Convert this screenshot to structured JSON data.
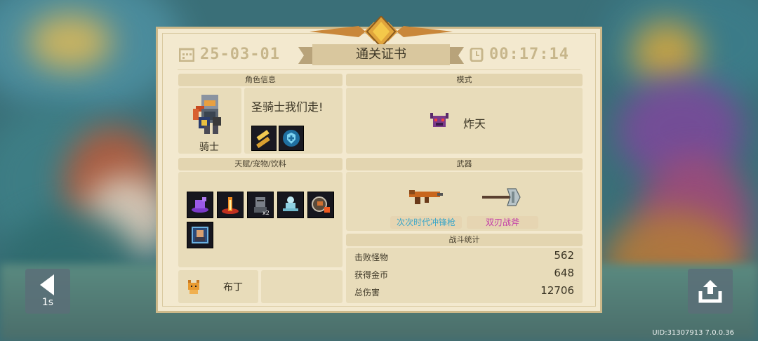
{
  "certificate": {
    "date": "25-03-01",
    "title": "通关证书",
    "time": "00:17:14"
  },
  "character": {
    "header": "角色信息",
    "hero_name": "骑士",
    "title_line": "圣骑士我们走!",
    "skills": [
      "golden-gun-skill-icon",
      "shield-buff-icon"
    ]
  },
  "mode": {
    "header": "模式",
    "name": "炸天",
    "icon": "horned-demon-icon"
  },
  "talents": {
    "header": "天赋/宠物/饮料",
    "items": [
      {
        "icon": "purple-wolf-talent-icon"
      },
      {
        "icon": "fire-pillar-talent-icon"
      },
      {
        "icon": "armored-knight-x2-talent-icon",
        "badge": "x2"
      },
      {
        "icon": "meditating-spirit-talent-icon"
      },
      {
        "icon": "flaming-orb-talent-icon"
      },
      {
        "icon": "portrait-talent-icon"
      }
    ],
    "pet_name": "布丁",
    "pet_icon": "orange-cat-pet-icon"
  },
  "weapons": {
    "header": "武器",
    "items": [
      {
        "name": "次次时代冲锋枪",
        "color": "#3aa6c8",
        "icon": "smg-icon"
      },
      {
        "name": "双刃战斧",
        "color": "#c23aa8",
        "icon": "double-axe-icon"
      }
    ]
  },
  "stats": {
    "header": "战斗统计",
    "rows": [
      {
        "label": "击败怪物",
        "value": "562"
      },
      {
        "label": "获得金币",
        "value": "648"
      },
      {
        "label": "总伤害",
        "value": "12706"
      }
    ]
  },
  "controls": {
    "back_label": "1s",
    "share_icon": "share-icon"
  },
  "footer": {
    "uid": "UID:31307913 7.0.0.36"
  }
}
